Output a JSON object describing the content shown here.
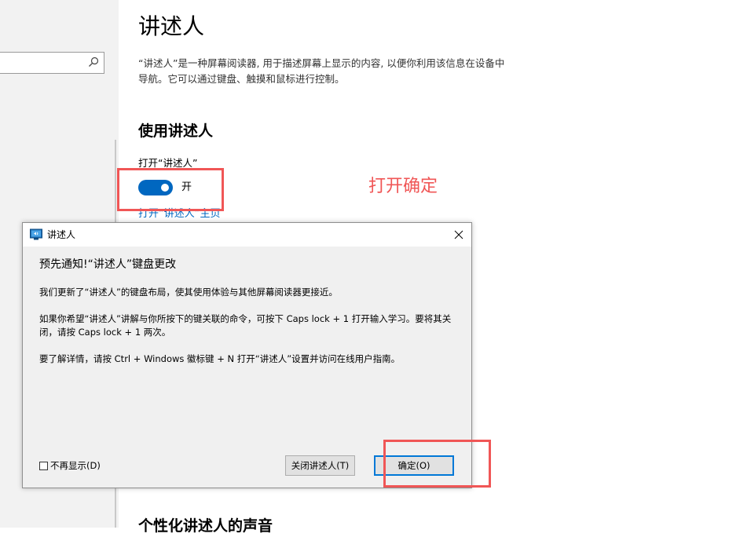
{
  "settings": {
    "page_title": "讲述人",
    "description": "“讲述人”是一种屏幕阅读器, 用于描述屏幕上显示的内容, 以便你利用该信息在设备中导航。它可以通过键盘、触摸和鼠标进行控制。",
    "section_title": "使用讲述人",
    "toggle_label": "打开“讲述人”",
    "toggle_state": "开",
    "toggle_on": true,
    "home_link": "打开“讲述人”主页",
    "bottom_section_title": "个性化讲述人的声音"
  },
  "annotation": {
    "text": "打开确定",
    "color": "#f05656"
  },
  "dialog": {
    "title": "讲述人",
    "heading": "预先通知!“讲述人”键盘更改",
    "paragraphs": [
      "我们更新了“讲述人”的键盘布局，使其使用体验与其他屏幕阅读器更接近。",
      "如果你希望“讲述人”讲解与你所按下的键关联的命令，可按下 Caps lock + 1 打开输入学习。要将其关闭，请按 Caps lock + 1 两次。",
      "要了解详情，请按 Ctrl + Windows 徽标键 + N 打开“讲述人”设置并访问在线用户指南。"
    ],
    "checkbox_label": "不再显示(D)",
    "checkbox_checked": false,
    "close_narrator_button": "关闭讲述人(T)",
    "ok_button": "确定(O)"
  },
  "colors": {
    "accent": "#0067c0",
    "annotation": "#f05656"
  }
}
